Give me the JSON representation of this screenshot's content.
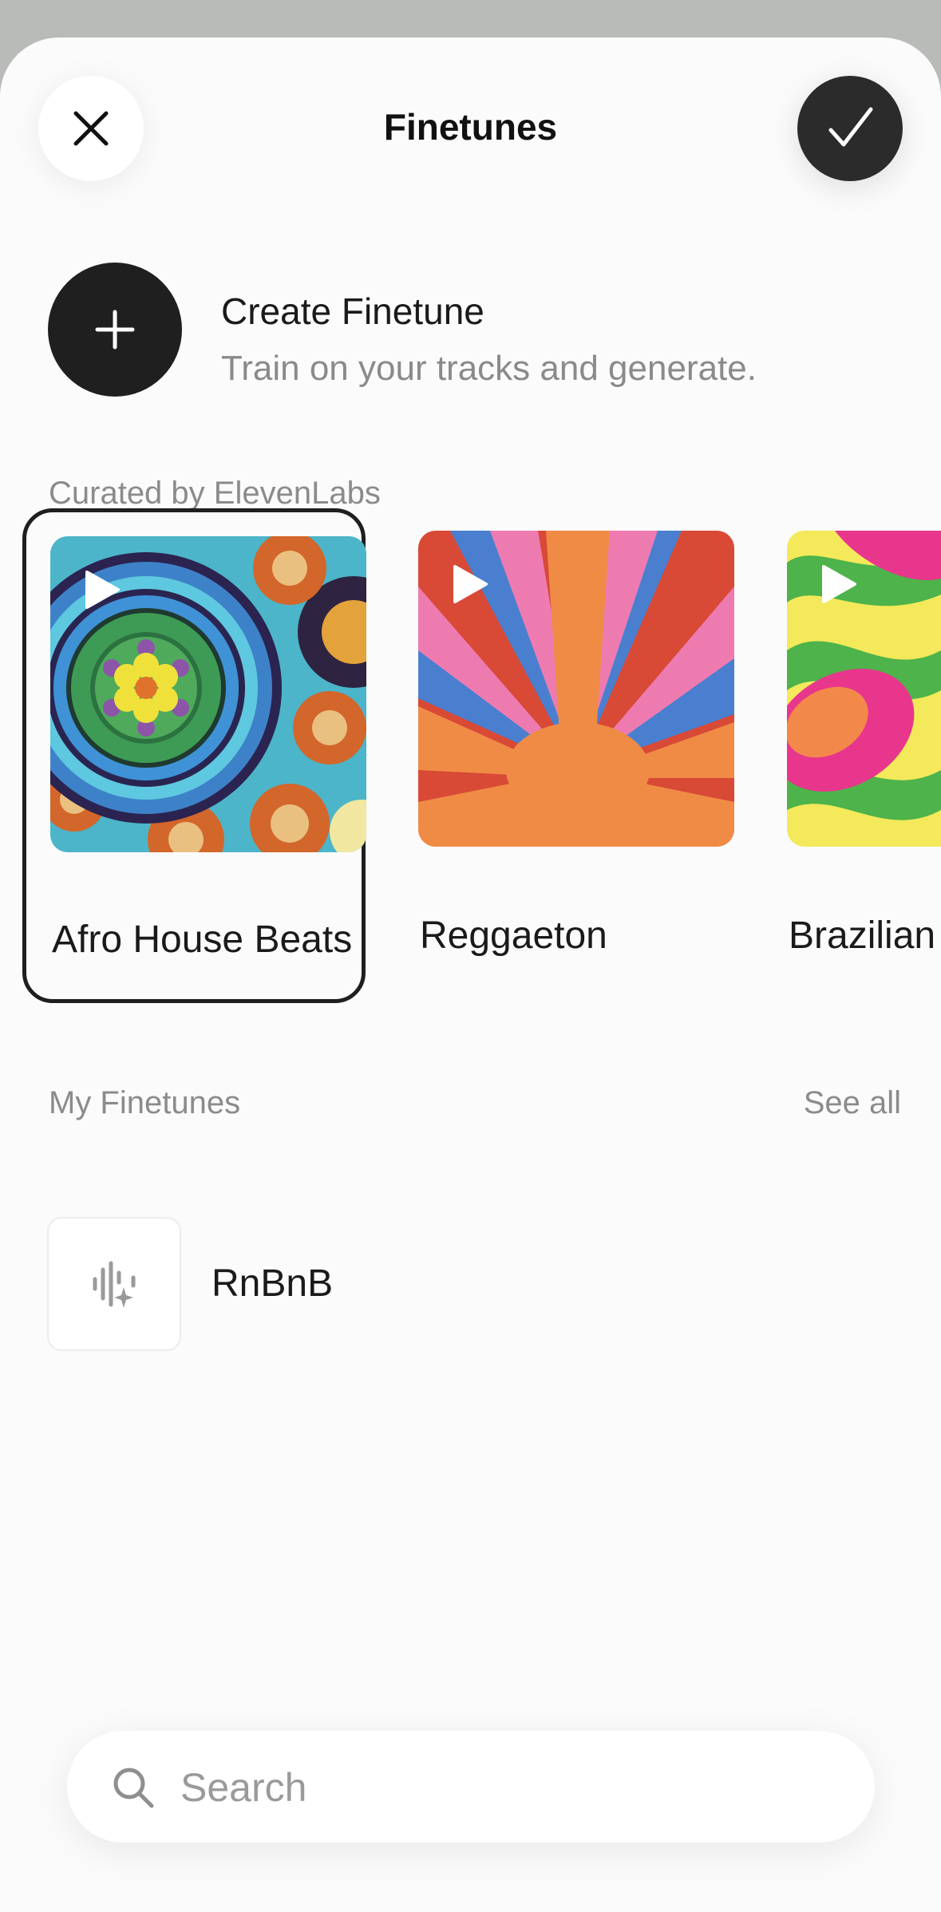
{
  "header": {
    "title": "Finetunes"
  },
  "create": {
    "title": "Create Finetune",
    "subtitle": "Train on your tracks and generate."
  },
  "curated": {
    "label": "Curated by ElevenLabs",
    "items": [
      {
        "label": "Afro House Beats",
        "selected": true
      },
      {
        "label": "Reggaeton",
        "selected": false
      },
      {
        "label": "Brazilian",
        "selected": false
      }
    ]
  },
  "my_finetunes": {
    "label": "My Finetunes",
    "see_all": "See all",
    "items": [
      {
        "label": "RnBnB",
        "icon": "waveform-sparkle-icon"
      }
    ]
  },
  "search": {
    "placeholder": "Search"
  },
  "colors": {
    "dark_button": "#2b2b2b",
    "selected_border": "#1f1f1f",
    "muted_text": "#8b8b8b"
  }
}
